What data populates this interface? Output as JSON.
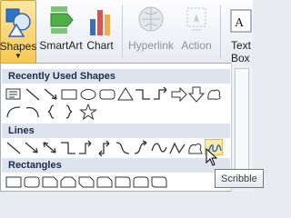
{
  "ribbon": {
    "shapes_label": "Shapes",
    "smartart_label": "SmartArt",
    "chart_label": "Chart",
    "hyperlink_label": "Hyperlink",
    "action_label": "Action",
    "textbox_label_1": "Text",
    "textbox_label_2": "Box"
  },
  "gallery": {
    "recently_used_header": "Recently Used Shapes",
    "lines_header": "Lines",
    "rectangles_header": "Rectangles"
  },
  "tooltip": {
    "text": "Scribble"
  },
  "colors": {
    "accent": "#2d63b3",
    "hover": "#fce8a8",
    "header": "#dde4ee"
  }
}
